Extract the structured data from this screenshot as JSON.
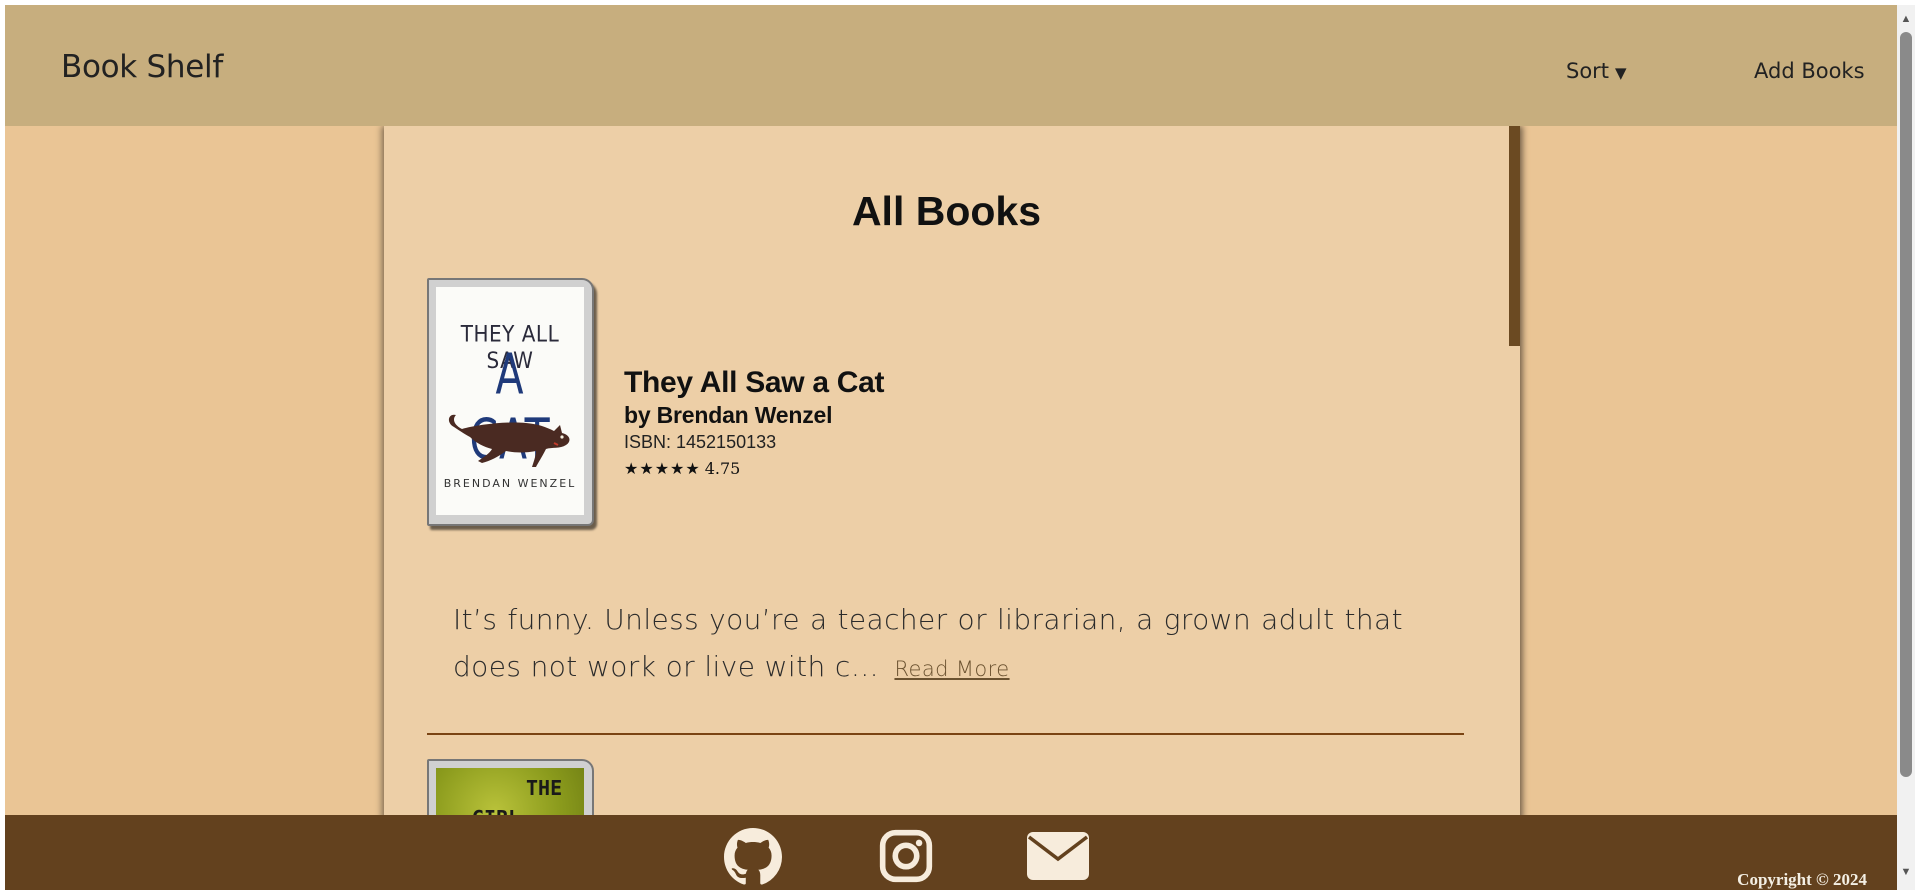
{
  "navbar": {
    "brand": "Book Shelf",
    "sort_label": "Sort",
    "sort_caret": "▼",
    "add_books_label": "Add Books"
  },
  "main": {
    "page_title": "All Books",
    "books": [
      {
        "cover": {
          "line1": "THEY ALL SAW",
          "line2": "A CAT",
          "author": "BRENDAN WENZEL"
        },
        "title": "They All Saw a Cat",
        "author": "by Brendan Wenzel",
        "isbn": "ISBN: 1452150133",
        "stars": "★★★★★",
        "rating": "4.75",
        "excerpt": "It’s funny. Unless you’re a teacher or librarian, a grown adult that does not work or live with c…",
        "read_more": "Read More"
      },
      {
        "cover": {
          "line1": "THE",
          "line2": "GIRL"
        }
      }
    ]
  },
  "footer": {
    "icons": [
      "github-icon",
      "instagram-icon",
      "mail-icon"
    ],
    "copyright": "Copyright © 2024"
  },
  "colors": {
    "navbar": "#c7ae7e",
    "background": "#eac595",
    "panel": "#edcfa7",
    "footer": "#63411e",
    "divider": "#7a4413"
  }
}
